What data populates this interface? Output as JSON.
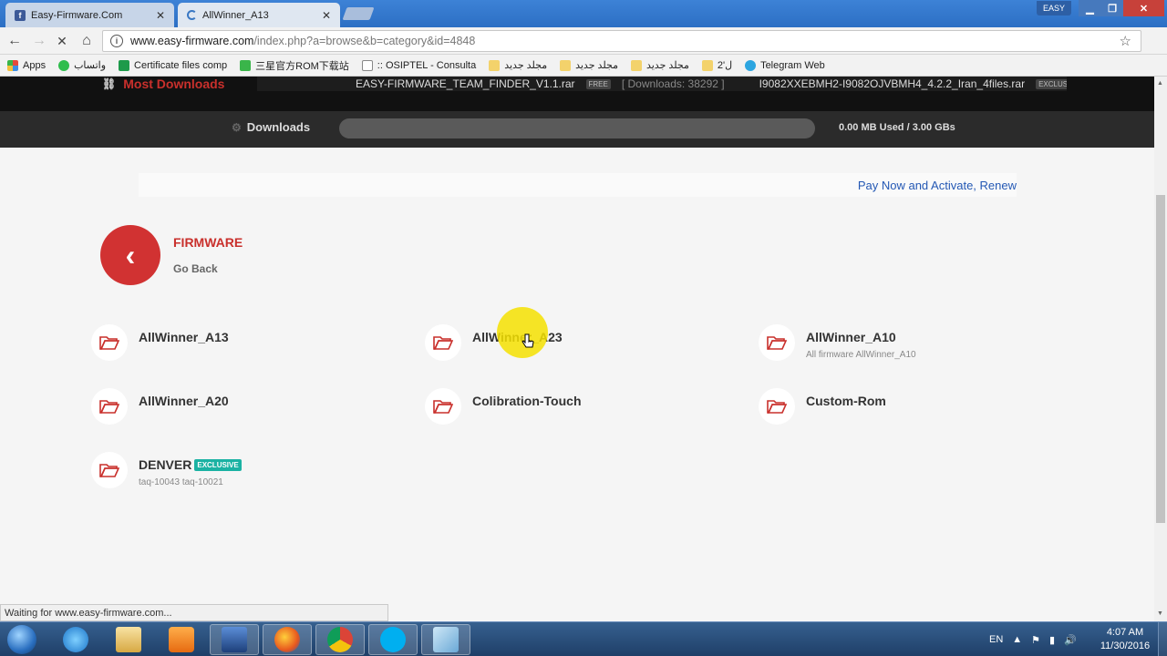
{
  "browser": {
    "tabs": [
      {
        "title": "Easy-Firmware.Com",
        "favicon": "facebook-icon"
      },
      {
        "title": "AllWinner_A13",
        "favicon": "loading-spinner-icon"
      }
    ],
    "profile_label": "EASY",
    "url_host": "www.easy-firmware.com",
    "url_path": "/index.php?a=browse&b=category&id=4848",
    "bookmarks": [
      {
        "label": "Apps",
        "icon": "apps-grid-icon",
        "color": "#e54a3c"
      },
      {
        "label": "واتساب",
        "icon": "whatsapp-icon",
        "color": "#2fbd4d"
      },
      {
        "label": "Certificate files comp",
        "icon": "sheet-icon",
        "color": "#1d9a4a"
      },
      {
        "label": "三星官方ROM下载站",
        "icon": "r-icon",
        "color": "#3ab54a"
      },
      {
        "label": ":: OSIPTEL - Consulta",
        "icon": "page-icon",
        "color": "#ffffff"
      },
      {
        "label": "مجلد جديد",
        "icon": "folder-icon",
        "color": "#f3d26b"
      },
      {
        "label": "مجلد جديد",
        "icon": "folder-icon",
        "color": "#f3d26b"
      },
      {
        "label": "مجلد جديد",
        "icon": "folder-icon",
        "color": "#f3d26b"
      },
      {
        "label": "2'ل",
        "icon": "folder-icon",
        "color": "#f3d26b"
      },
      {
        "label": "Telegram Web",
        "icon": "telegram-icon",
        "color": "#2ca5e0"
      }
    ],
    "status_text": "Waiting for www.easy-firmware.com..."
  },
  "site": {
    "most_downloads_label": "Most Downloads",
    "ticker": [
      {
        "file": "EASY-FIRMWARE_TEAM_FINDER_V1.1.rar",
        "badge": "FREE",
        "meta": "[ Downloads: 38292 ]"
      },
      {
        "file": "I9082XXEBMH2-I9082OJVBMH4_4.2.2_Iran_4files.rar",
        "badge": "EXCLUSIVE",
        "meta": ""
      }
    ],
    "downloads_label": "Downloads",
    "downloads_progress": 0.0,
    "usage_text": "0.00 MB Used / 3.00 GBs",
    "pay_link": "Pay Now and Activate, Renew",
    "back": {
      "title": "FIRMWARE",
      "subtitle": "Go Back"
    },
    "categories": [
      {
        "name": "AllWinner_A13",
        "desc": "",
        "badge": ""
      },
      {
        "name": "AllWinner_A23",
        "desc": "",
        "badge": ""
      },
      {
        "name": "AllWinner_A10",
        "desc": "All firmware AllWinner_A10",
        "badge": ""
      },
      {
        "name": "AllWinner_A20",
        "desc": "",
        "badge": ""
      },
      {
        "name": "Colibration-Touch",
        "desc": "",
        "badge": ""
      },
      {
        "name": "Custom-Rom",
        "desc": "",
        "badge": ""
      },
      {
        "name": "DENVER",
        "desc": "taq-10043 taq-10021",
        "badge": "EXCLUSIVE"
      }
    ]
  },
  "taskbar": {
    "apps": [
      "internet-explorer-icon",
      "file-explorer-icon",
      "media-player-icon",
      "network-tool-icon",
      "firefox-icon",
      "chrome-icon",
      "skype-icon",
      "notepad-icon"
    ],
    "language": "EN",
    "time": "4:07 AM",
    "date": "11/30/2016"
  },
  "colors": {
    "accent_red": "#d13232",
    "link_blue": "#2458b4",
    "badge_teal": "#1bb2a3"
  }
}
